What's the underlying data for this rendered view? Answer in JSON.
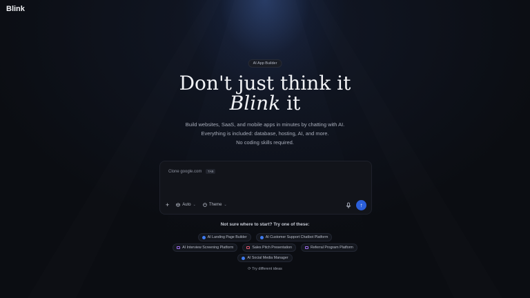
{
  "app": {
    "logo": "Blink"
  },
  "hero": {
    "badge": "AI App Builder",
    "headline_line1": "Don't just think it",
    "headline_line2_italic": "Blink",
    "headline_line2_rest": " it",
    "sub_line1": "Build websites, SaaS, and mobile apps in minutes by chatting with AI.",
    "sub_line2": "Everything is included: database, hosting, AI, and more.",
    "sub_line3": "No coding skills required."
  },
  "prompt": {
    "placeholder": "Clone google.com",
    "tab_hint": "TAB",
    "add_icon": "plus-icon",
    "model_label": "Auto",
    "theme_label": "Theme",
    "mic_icon": "microphone-icon",
    "send_icon": "arrow-up-icon",
    "send_color": "#2b5fd9"
  },
  "suggestions": {
    "title": "Not sure where to start? Try one of these:",
    "row1": [
      {
        "label": "AI Landing Page Builder",
        "icon": "globe-icon",
        "color": "#3e7bf0"
      },
      {
        "label": "AI Customer Support Chatbot Platform",
        "icon": "globe-icon",
        "color": "#3e7bf0"
      }
    ],
    "row2": [
      {
        "label": "AI Interview Screening Platform",
        "icon": "monitor-icon",
        "color": "#a06cf0"
      },
      {
        "label": "Sales Pitch Presentation",
        "icon": "presentation-icon",
        "color": "#e0566e"
      },
      {
        "label": "Referral Program Platform",
        "icon": "monitor-icon",
        "color": "#a06cf0"
      }
    ],
    "row3": [
      {
        "label": "AI Social Media Manager",
        "icon": "globe-icon",
        "color": "#3e7bf0"
      }
    ],
    "refresh_label": "Try different ideas"
  }
}
